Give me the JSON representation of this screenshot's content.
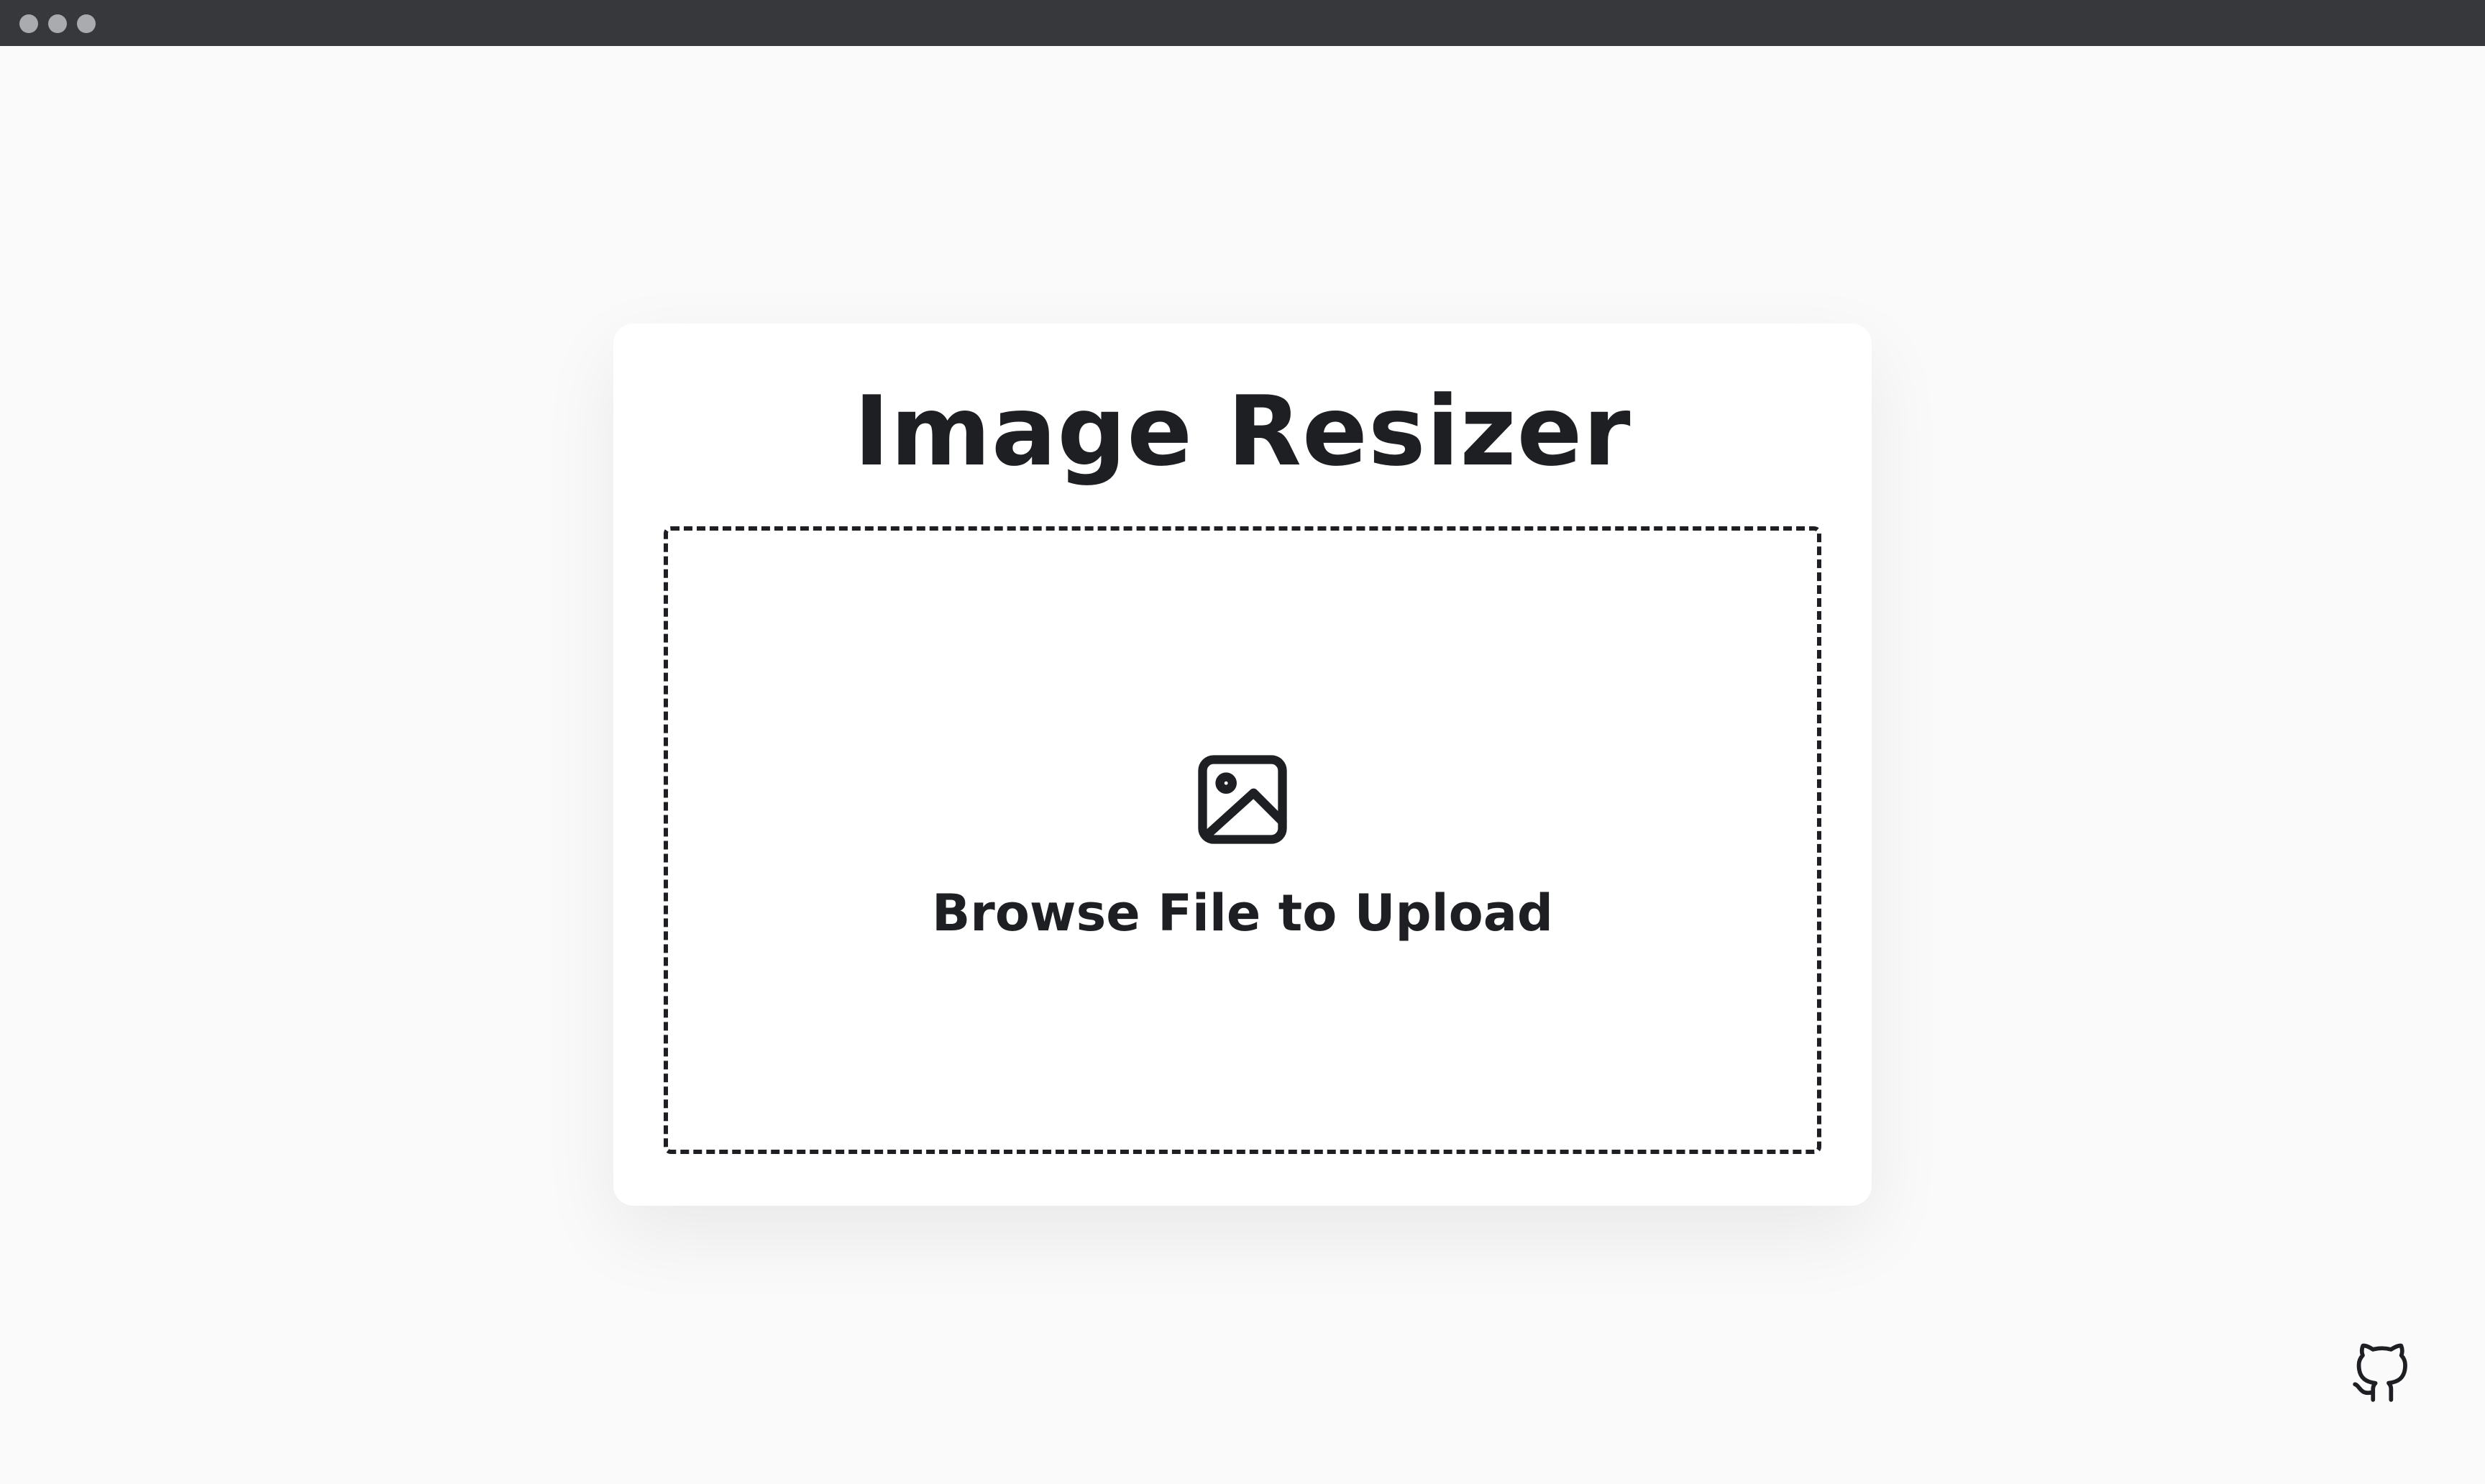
{
  "app": {
    "title": "Image Resizer"
  },
  "upload": {
    "label": "Browse File to Upload",
    "icon": "image-icon"
  },
  "footer": {
    "github_icon": "github-icon"
  },
  "colors": {
    "background": "#fafafa",
    "card": "#ffffff",
    "text": "#1d1f22",
    "window_bar": "#37383b",
    "window_dots": "#a9abae"
  }
}
